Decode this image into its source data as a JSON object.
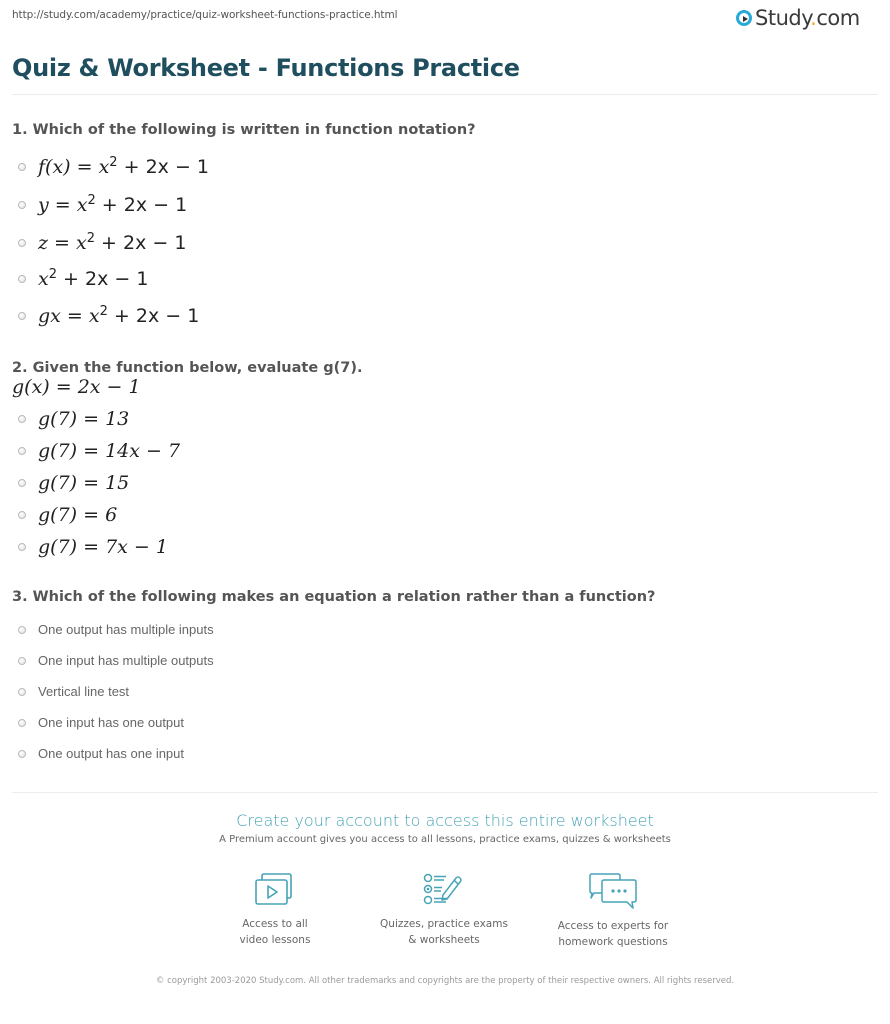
{
  "header": {
    "url": "http://study.com/academy/practice/quiz-worksheet-functions-practice.html",
    "logo_text_main": "Study",
    "logo_text_dot": ".",
    "logo_text_tail": "com",
    "logo_icon": "play-circle-icon"
  },
  "page_title": "Quiz & Worksheet - Functions Practice",
  "questions": [
    {
      "text": "1. Which of the following is written in function notation?",
      "options": [
        {
          "pre": "f(x) = x",
          "sup": "2",
          "post": " + 2x − 1"
        },
        {
          "pre": "y = x",
          "sup": "2",
          "post": " + 2x − 1"
        },
        {
          "pre": "z = x",
          "sup": "2",
          "post": " + 2x − 1"
        },
        {
          "pre": "x",
          "sup": "2",
          "post": " + 2x − 1"
        },
        {
          "pre": "gx = x",
          "sup": "2",
          "post": " + 2x − 1"
        }
      ]
    },
    {
      "text": "2. Given the function below, evaluate g(7).",
      "given": "g(x) = 2x − 1",
      "options": [
        {
          "text": "g(7) = 13"
        },
        {
          "text": "g(7) = 14x − 7"
        },
        {
          "text": "g(7) = 15"
        },
        {
          "text": "g(7) = 6"
        },
        {
          "text": "g(7) = 7x − 1"
        }
      ]
    },
    {
      "text": "3. Which of the following makes an equation a relation rather than a function?",
      "options": [
        {
          "text": "One output has multiple inputs"
        },
        {
          "text": "One input has multiple outputs"
        },
        {
          "text": "Vertical line test"
        },
        {
          "text": "One input has one output"
        },
        {
          "text": "One output has one input"
        }
      ]
    }
  ],
  "promo": {
    "title": "Create your account to access this entire worksheet",
    "subtitle": "A Premium account gives you access to all lessons, practice exams, quizzes & worksheets",
    "accent_color": "#47a4b6",
    "features": [
      {
        "icon": "video-lessons-icon",
        "line1": "Access to all",
        "line2": "video lessons"
      },
      {
        "icon": "quiz-checklist-icon",
        "line1": "Quizzes, practice exams",
        "line2": "& worksheets"
      },
      {
        "icon": "chat-bubbles-icon",
        "line1": "Access to experts for",
        "line2": "homework questions"
      }
    ]
  },
  "footer": {
    "copyright": "© copyright 2003-2020 Study.com. All other trademarks and copyrights are the property of their respective owners. All rights reserved."
  }
}
